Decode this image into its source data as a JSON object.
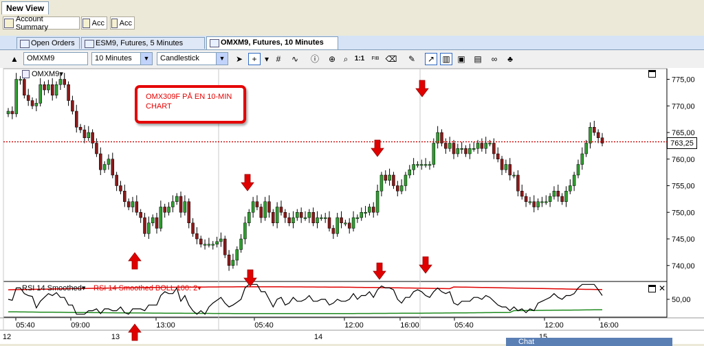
{
  "window": {
    "title": "New View"
  },
  "workspace_tabs": [
    "Account Summary",
    "Acc",
    "Acc"
  ],
  "chart_tabs": [
    {
      "label": "Open Orders",
      "active": false
    },
    {
      "label": "ESM9, Futures, 5 Minutes",
      "active": false
    },
    {
      "label": "OMXM9, Futures, 10 Minutes",
      "active": true
    }
  ],
  "toolbar": {
    "symbol": "OMXM9",
    "interval": "10 Minutes",
    "chart_type": "Candlestick",
    "ratio_label": "1:1",
    "fib_label": "FIB"
  },
  "chart": {
    "symbol_label": "OMXM9",
    "annotation": [
      "OMX309F PÅ EN 10-MIN",
      "CHART"
    ],
    "last_price": "763,25",
    "rsi_label": "RSI 14 Smoothed",
    "boll_label": "RSI 14 Smoothed BOLL 100: 2",
    "rsi_axis_label": "50,00",
    "chat_label": "Chat",
    "colors": {
      "up": "#2e9e2e",
      "down": "#8b1a1a",
      "boll_upper": "#e00000",
      "boll_lower": "#1e8a1e",
      "arrow": "#e00000"
    }
  },
  "chart_data": {
    "type": "candlestick",
    "ylim": [
      737,
      777
    ],
    "price_ticks": [
      "775,00",
      "770,00",
      "765,00",
      "760,00",
      "755,00",
      "750,00",
      "745,00",
      "740,00"
    ],
    "time_ticks": [
      "05:40",
      "09:00",
      "13:00",
      "05:40",
      "12:00",
      "16:00",
      "05:40",
      "12:00",
      "16:00"
    ],
    "date_ticks": [
      "12",
      "13",
      "14",
      "15"
    ],
    "closes": [
      769,
      768.5,
      775,
      775,
      772,
      771,
      770,
      770.5,
      774,
      773,
      774,
      772,
      774,
      775,
      774,
      771,
      769,
      766,
      765.5,
      764,
      765,
      763,
      761,
      758,
      759,
      760,
      757,
      755,
      754,
      752,
      751,
      752,
      750,
      749,
      746,
      748,
      749,
      747,
      751,
      750,
      751,
      752,
      753,
      750,
      752,
      748,
      746,
      745,
      744,
      744,
      744,
      744,
      744.5,
      745,
      742,
      740,
      741,
      743,
      745,
      748,
      750,
      752,
      751,
      749,
      752,
      750,
      748,
      751,
      750,
      749,
      748,
      749,
      750,
      749,
      749,
      750,
      748,
      749,
      749,
      749,
      747,
      746,
      749,
      748,
      748,
      747,
      749,
      749,
      750,
      750,
      751,
      750,
      754,
      757,
      756,
      757,
      755,
      754,
      755,
      757,
      758,
      759,
      759,
      759,
      759,
      759,
      763,
      765,
      763,
      762,
      763,
      761,
      762,
      762,
      761,
      762,
      762,
      763,
      762,
      763,
      763,
      761,
      760,
      758,
      759,
      757,
      757,
      754,
      753,
      752,
      752,
      751,
      752,
      752,
      752,
      753,
      754,
      753,
      752,
      754,
      755,
      757,
      759,
      761,
      763,
      766,
      765,
      764,
      763
    ]
  }
}
